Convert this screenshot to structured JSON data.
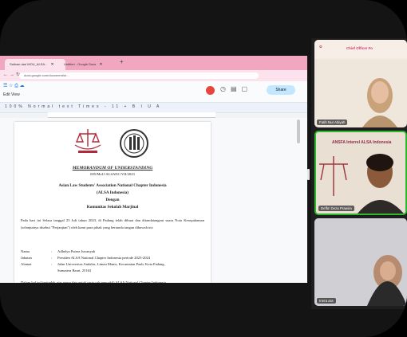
{
  "browser": {
    "tabs": [
      {
        "label": "Salinan dari MOU_ALSA..."
      },
      {
        "label": "Untitled - Google Docs"
      }
    ],
    "url": "docs.google.com/document/d/..."
  },
  "docs": {
    "menu": "Edit  View",
    "share_label": "Share",
    "tool_row": "100%  Normal text  Times  -  11  +  B  I  U  A"
  },
  "document": {
    "mou_title": "MEMORANDUM OF UNDERSTANDING",
    "number": "005/MoU/ALSANC/VII/2023",
    "party1": "Asian Law Students' Association National Chapter Indonesia",
    "party1_abbr": "(ALSA Indonesia)",
    "conj": "Dengan",
    "party2": "Komunitas Sekolah Marjinal",
    "paragraph": "Pada hari ini Selasa tanggal 25 Juli tahun 2023, di Padang telah dibuat dan ditandatangani suatu Nota Kesepahaman (selanjutnya disebut \"Perjanjian\") oleh kami para pihak yang bertanda tangan dibawah ini:",
    "fields": [
      {
        "label": "Nama",
        "value": "Adhelya Putera Iswanyah"
      },
      {
        "label": "Jabatan",
        "value": "Presiden ALSA National Chapter Indonesia periode 2023-2024"
      },
      {
        "label": "Alamat",
        "value": "Jalan Universitas Andalas, Limau Manis, Kecamatan Pauh, Kota Padang,"
      }
    ],
    "address_cont": "Sumatera Barat, 25163",
    "cut_line": "Dalam hal ini bertindak atas nama dan untuk serta sah mewakili ALSA National Chapter Indonesia"
  },
  "participants": [
    {
      "name": "Fatih Nur Abiyah",
      "slide_title": "Chief Officer Fo"
    },
    {
      "name": "Deffa' Deza Prawira",
      "slide_text": "ANSFA Interrel ALSA Indonesia"
    },
    {
      "name": "Inera ara"
    }
  ]
}
